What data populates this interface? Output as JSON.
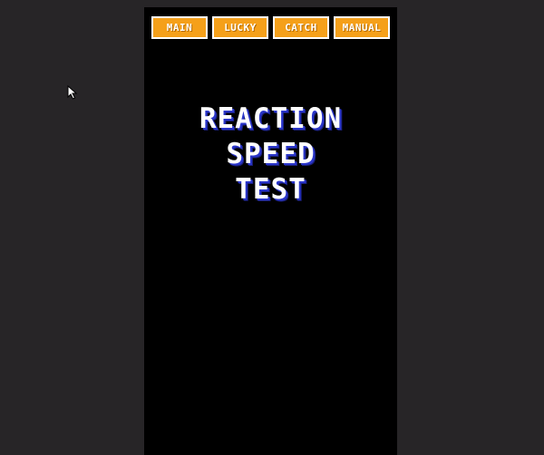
{
  "nav": {
    "buttons": [
      {
        "label": "MAIN"
      },
      {
        "label": "LUCKY"
      },
      {
        "label": "CATCH"
      },
      {
        "label": "MANUAL"
      }
    ]
  },
  "title": {
    "lines": [
      "REACTION",
      "SPEED",
      "TEST"
    ]
  },
  "colors": {
    "page_background": "#272527",
    "game_background": "#000000",
    "button_fill": "#f5a01a",
    "button_border": "#ffffff",
    "title_text": "#ffffff",
    "title_shadow": "#2a35c9"
  },
  "icons": {
    "cursor": "mouse-pointer-icon"
  }
}
